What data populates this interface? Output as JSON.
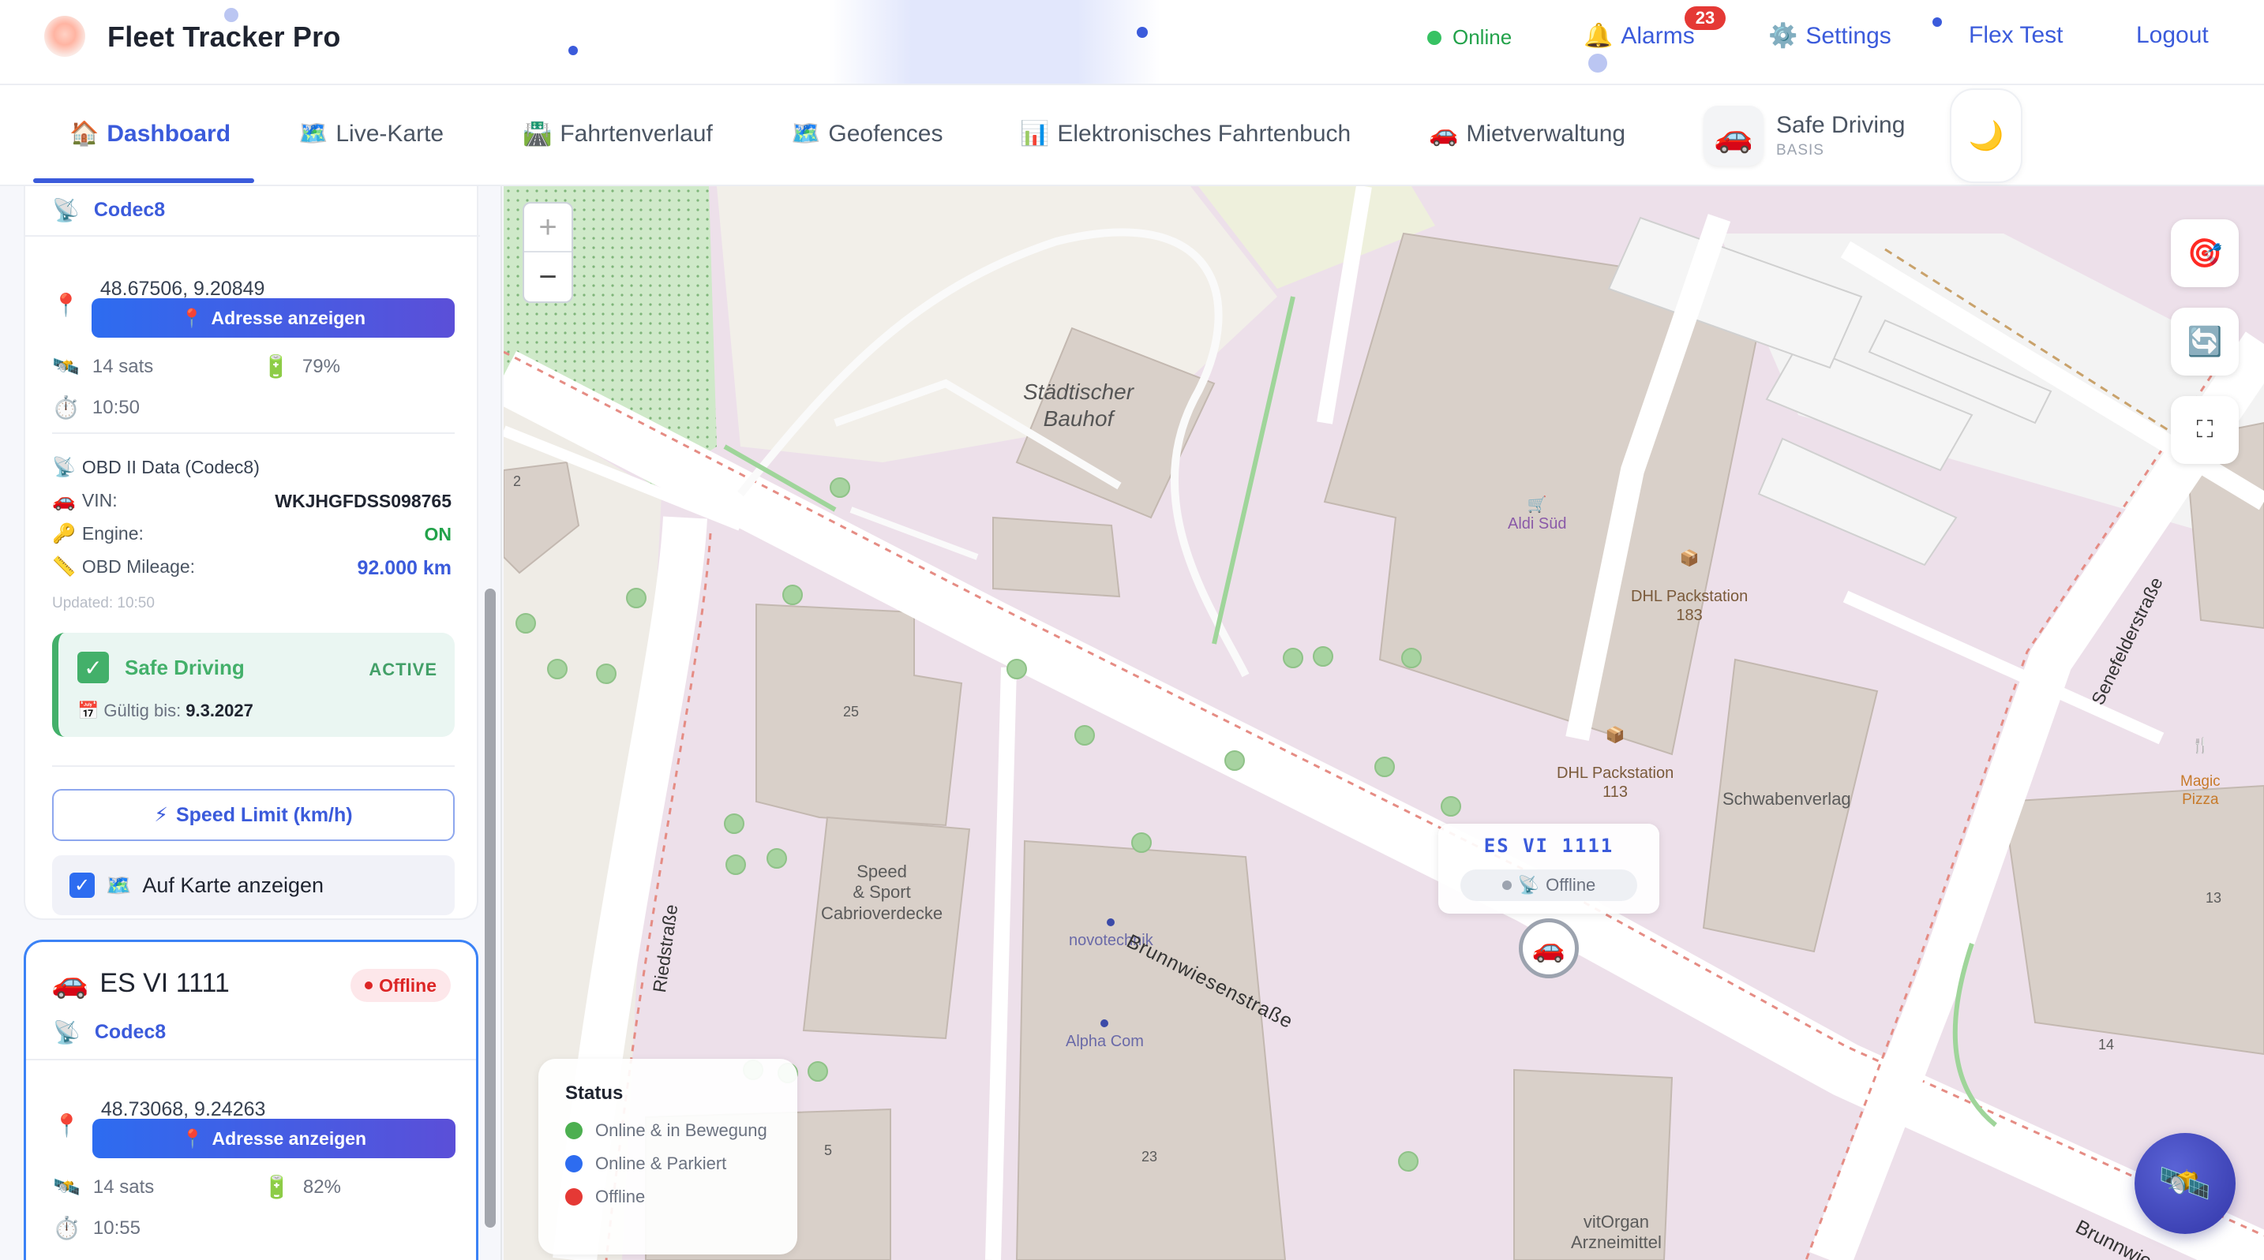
{
  "app": {
    "title": "Fleet Tracker Pro"
  },
  "header": {
    "online_label": "Online",
    "alarms_label": "Alarms",
    "alarms_count": "23",
    "settings_label": "Settings",
    "user_label": "Flex Test",
    "logout_label": "Logout",
    "icons": {
      "alarm": "bell-icon",
      "settings": "gear-icon"
    }
  },
  "tabs": [
    {
      "label": "Dashboard",
      "icon": "home-icon",
      "glyph": "🏠",
      "active": true
    },
    {
      "label": "Live-Karte",
      "icon": "map-icon",
      "glyph": "🗺️"
    },
    {
      "label": "Fahrtenverlauf",
      "icon": "route-icon",
      "glyph": "🛣️"
    },
    {
      "label": "Geofences",
      "icon": "map-icon",
      "glyph": "🗺️"
    },
    {
      "label": "Elektronisches Fahrtenbuch",
      "icon": "chart-icon",
      "glyph": "📊"
    },
    {
      "label": "Mietverwaltung",
      "icon": "car-icon",
      "glyph": "🚗"
    }
  ],
  "safe_driving_pill": {
    "title": "Safe Driving",
    "tier": "BASIS"
  },
  "sidebar": {
    "vehicle1": {
      "protocol": "Codec8",
      "coords": "48.67506, 9.20849",
      "address_button": "Adresse anzeigen",
      "sats": "14 sats",
      "battery": "79%",
      "time": "10:50",
      "obd_title": "OBD II Data (Codec8)",
      "vin_label": "VIN:",
      "vin_value": "WKJHGFDSS098765",
      "engine_label": "Engine:",
      "engine_value": "ON",
      "mileage_label": "OBD Mileage:",
      "mileage_value": "92.000 km",
      "updated": "Updated: 10:50",
      "safe_title": "Safe Driving",
      "safe_status": "ACTIVE",
      "valid_label": "Gültig bis:",
      "valid_date": "9.3.2027",
      "speed_button": "Speed Limit (km/h)",
      "map_toggle": "Auf Karte anzeigen"
    },
    "vehicle2": {
      "plate": "ES VI 1111",
      "status": "Offline",
      "protocol": "Codec8",
      "coords": "48.73068, 9.24263",
      "address_button": "Adresse anzeigen",
      "sats": "14 sats",
      "battery": "82%",
      "time": "10:55"
    }
  },
  "map": {
    "zoom_in": "+",
    "zoom_out": "−",
    "places": {
      "bauhof": "Städtischer\nBauhof",
      "aldi": "Aldi Süd",
      "dhl183": "DHL Packstation\n183",
      "dhl113": "DHL Packstation\n113",
      "schwaben": "Schwabenverlag",
      "speed": "Speed\n& Sport\nCabrioverdecke",
      "novo": "novotechnik",
      "alpha": "Alpha Com",
      "vitorgan": "vitOrgan\nArzneimittel",
      "magic": "Magic\nPizza",
      "brunn": "Brunnwiesenstraße",
      "brunn2": "Brunnwie",
      "ried": "Riedstraße",
      "senefelder": "Senefelderstraße",
      "n25": "25",
      "n23": "23",
      "n2": "2",
      "n5": "5",
      "n13": "13",
      "n14": "14"
    },
    "vehicle_popup": {
      "plate": "ES VI 1111",
      "status": "Offline"
    },
    "legend": {
      "title": "Status",
      "items": [
        {
          "label": "Online & in Bewegung",
          "color": "#4caf50"
        },
        {
          "label": "Online & Parkiert",
          "color": "#2d6cf0"
        },
        {
          "label": "Offline",
          "color": "#e53935"
        }
      ]
    }
  },
  "colors": {
    "accent": "#3b5bdb",
    "online": "#37c263",
    "offline": "#e53935",
    "safe_green": "#43b06a"
  }
}
